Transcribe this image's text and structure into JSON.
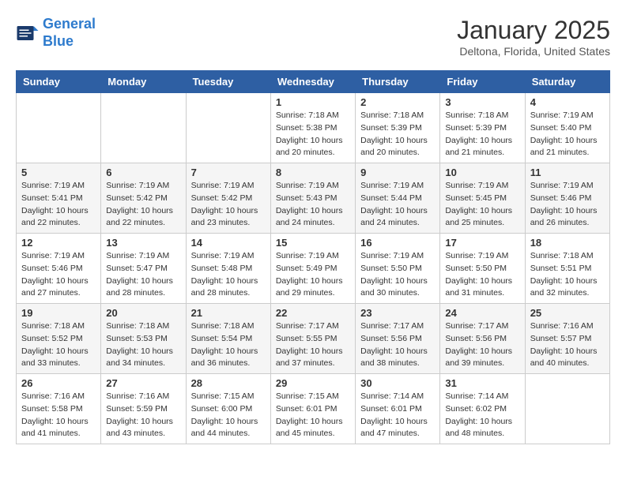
{
  "header": {
    "logo_line1": "General",
    "logo_line2": "Blue",
    "month": "January 2025",
    "location": "Deltona, Florida, United States"
  },
  "days_of_week": [
    "Sunday",
    "Monday",
    "Tuesday",
    "Wednesday",
    "Thursday",
    "Friday",
    "Saturday"
  ],
  "weeks": [
    [
      {
        "day": "",
        "info": ""
      },
      {
        "day": "",
        "info": ""
      },
      {
        "day": "",
        "info": ""
      },
      {
        "day": "1",
        "info": "Sunrise: 7:18 AM\nSunset: 5:38 PM\nDaylight: 10 hours\nand 20 minutes."
      },
      {
        "day": "2",
        "info": "Sunrise: 7:18 AM\nSunset: 5:39 PM\nDaylight: 10 hours\nand 20 minutes."
      },
      {
        "day": "3",
        "info": "Sunrise: 7:18 AM\nSunset: 5:39 PM\nDaylight: 10 hours\nand 21 minutes."
      },
      {
        "day": "4",
        "info": "Sunrise: 7:19 AM\nSunset: 5:40 PM\nDaylight: 10 hours\nand 21 minutes."
      }
    ],
    [
      {
        "day": "5",
        "info": "Sunrise: 7:19 AM\nSunset: 5:41 PM\nDaylight: 10 hours\nand 22 minutes."
      },
      {
        "day": "6",
        "info": "Sunrise: 7:19 AM\nSunset: 5:42 PM\nDaylight: 10 hours\nand 22 minutes."
      },
      {
        "day": "7",
        "info": "Sunrise: 7:19 AM\nSunset: 5:42 PM\nDaylight: 10 hours\nand 23 minutes."
      },
      {
        "day": "8",
        "info": "Sunrise: 7:19 AM\nSunset: 5:43 PM\nDaylight: 10 hours\nand 24 minutes."
      },
      {
        "day": "9",
        "info": "Sunrise: 7:19 AM\nSunset: 5:44 PM\nDaylight: 10 hours\nand 24 minutes."
      },
      {
        "day": "10",
        "info": "Sunrise: 7:19 AM\nSunset: 5:45 PM\nDaylight: 10 hours\nand 25 minutes."
      },
      {
        "day": "11",
        "info": "Sunrise: 7:19 AM\nSunset: 5:46 PM\nDaylight: 10 hours\nand 26 minutes."
      }
    ],
    [
      {
        "day": "12",
        "info": "Sunrise: 7:19 AM\nSunset: 5:46 PM\nDaylight: 10 hours\nand 27 minutes."
      },
      {
        "day": "13",
        "info": "Sunrise: 7:19 AM\nSunset: 5:47 PM\nDaylight: 10 hours\nand 28 minutes."
      },
      {
        "day": "14",
        "info": "Sunrise: 7:19 AM\nSunset: 5:48 PM\nDaylight: 10 hours\nand 28 minutes."
      },
      {
        "day": "15",
        "info": "Sunrise: 7:19 AM\nSunset: 5:49 PM\nDaylight: 10 hours\nand 29 minutes."
      },
      {
        "day": "16",
        "info": "Sunrise: 7:19 AM\nSunset: 5:50 PM\nDaylight: 10 hours\nand 30 minutes."
      },
      {
        "day": "17",
        "info": "Sunrise: 7:19 AM\nSunset: 5:50 PM\nDaylight: 10 hours\nand 31 minutes."
      },
      {
        "day": "18",
        "info": "Sunrise: 7:18 AM\nSunset: 5:51 PM\nDaylight: 10 hours\nand 32 minutes."
      }
    ],
    [
      {
        "day": "19",
        "info": "Sunrise: 7:18 AM\nSunset: 5:52 PM\nDaylight: 10 hours\nand 33 minutes."
      },
      {
        "day": "20",
        "info": "Sunrise: 7:18 AM\nSunset: 5:53 PM\nDaylight: 10 hours\nand 34 minutes."
      },
      {
        "day": "21",
        "info": "Sunrise: 7:18 AM\nSunset: 5:54 PM\nDaylight: 10 hours\nand 36 minutes."
      },
      {
        "day": "22",
        "info": "Sunrise: 7:17 AM\nSunset: 5:55 PM\nDaylight: 10 hours\nand 37 minutes."
      },
      {
        "day": "23",
        "info": "Sunrise: 7:17 AM\nSunset: 5:56 PM\nDaylight: 10 hours\nand 38 minutes."
      },
      {
        "day": "24",
        "info": "Sunrise: 7:17 AM\nSunset: 5:56 PM\nDaylight: 10 hours\nand 39 minutes."
      },
      {
        "day": "25",
        "info": "Sunrise: 7:16 AM\nSunset: 5:57 PM\nDaylight: 10 hours\nand 40 minutes."
      }
    ],
    [
      {
        "day": "26",
        "info": "Sunrise: 7:16 AM\nSunset: 5:58 PM\nDaylight: 10 hours\nand 41 minutes."
      },
      {
        "day": "27",
        "info": "Sunrise: 7:16 AM\nSunset: 5:59 PM\nDaylight: 10 hours\nand 43 minutes."
      },
      {
        "day": "28",
        "info": "Sunrise: 7:15 AM\nSunset: 6:00 PM\nDaylight: 10 hours\nand 44 minutes."
      },
      {
        "day": "29",
        "info": "Sunrise: 7:15 AM\nSunset: 6:01 PM\nDaylight: 10 hours\nand 45 minutes."
      },
      {
        "day": "30",
        "info": "Sunrise: 7:14 AM\nSunset: 6:01 PM\nDaylight: 10 hours\nand 47 minutes."
      },
      {
        "day": "31",
        "info": "Sunrise: 7:14 AM\nSunset: 6:02 PM\nDaylight: 10 hours\nand 48 minutes."
      },
      {
        "day": "",
        "info": ""
      }
    ]
  ]
}
